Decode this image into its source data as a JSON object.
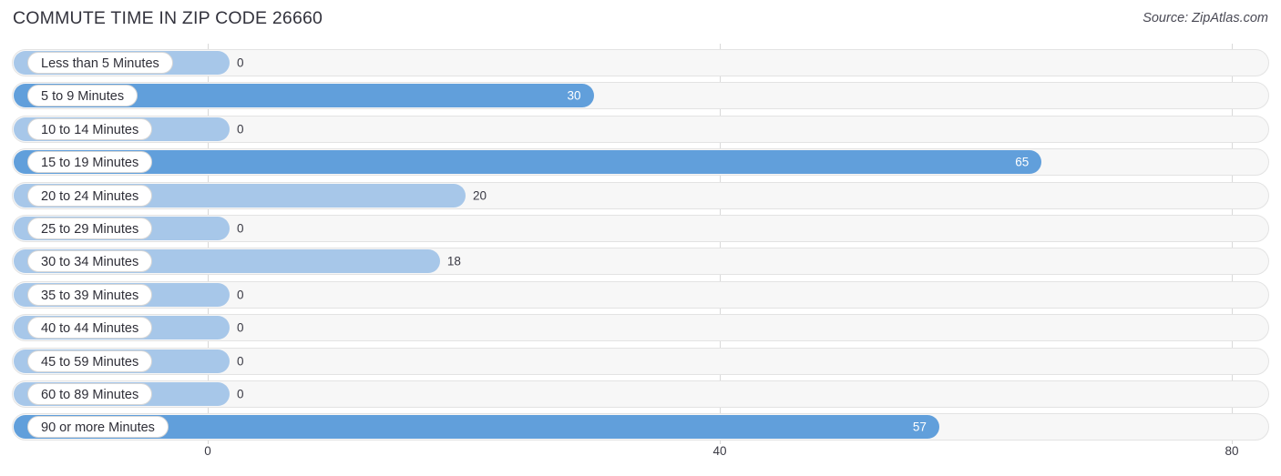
{
  "header": {
    "title": "COMMUTE TIME IN ZIP CODE 26660",
    "source": "Source: ZipAtlas.com"
  },
  "colors": {
    "bar_strong": "#619fdb",
    "bar_light": "#a7c7e9",
    "track": "#f7f7f7",
    "grid": "#d9d9d9",
    "text": "#3a3a44"
  },
  "chart_data": {
    "type": "bar",
    "orientation": "horizontal",
    "title": "COMMUTE TIME IN ZIP CODE 26660",
    "xlabel": "",
    "ylabel": "",
    "xlim": [
      0,
      80
    ],
    "xticks": [
      0,
      40,
      80
    ],
    "xtick_labels": [
      "0",
      "40",
      "80"
    ],
    "grid": true,
    "legend": false,
    "categories": [
      "Less than 5 Minutes",
      "5 to 9 Minutes",
      "10 to 14 Minutes",
      "15 to 19 Minutes",
      "20 to 24 Minutes",
      "25 to 29 Minutes",
      "30 to 34 Minutes",
      "35 to 39 Minutes",
      "40 to 44 Minutes",
      "45 to 59 Minutes",
      "60 to 89 Minutes",
      "90 or more Minutes"
    ],
    "values": [
      0,
      30,
      0,
      65,
      20,
      0,
      18,
      0,
      0,
      0,
      0,
      57
    ],
    "value_labels": [
      "0",
      "30",
      "0",
      "65",
      "20",
      "0",
      "18",
      "0",
      "0",
      "0",
      "0",
      "57"
    ]
  }
}
